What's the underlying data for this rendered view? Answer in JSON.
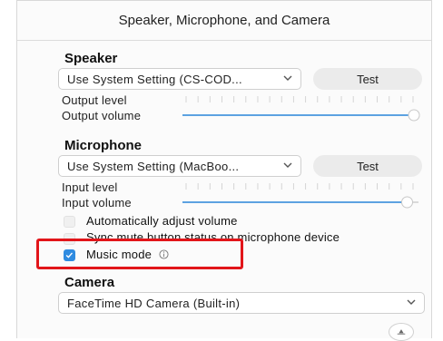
{
  "window": {
    "title": "Speaker, Microphone, and Camera"
  },
  "speaker": {
    "heading": "Speaker",
    "device": "Use System Setting (CS-COD...",
    "test_label": "Test",
    "output_level_label": "Output level",
    "output_volume_label": "Output volume",
    "output_volume_value": 1.0
  },
  "microphone": {
    "heading": "Microphone",
    "device": "Use System Setting (MacBoo...",
    "test_label": "Test",
    "input_level_label": "Input level",
    "input_volume_label": "Input volume",
    "input_volume_value": 0.97,
    "auto_adjust_label": "Automatically adjust volume",
    "auto_adjust_checked": false,
    "sync_mute_label": "Sync mute button status on microphone device",
    "sync_mute_checked": false,
    "music_mode_label": "Music mode",
    "music_mode_checked": true
  },
  "camera": {
    "heading": "Camera",
    "device": "FaceTime HD Camera (Built-in)"
  },
  "colors": {
    "accent": "#2f8be0",
    "highlight": "#e2151a"
  },
  "icons": {
    "dropdown": "chevron-down-icon",
    "info": "info-icon",
    "checkmark": "checkmark-icon",
    "settings": "gear-icon"
  }
}
